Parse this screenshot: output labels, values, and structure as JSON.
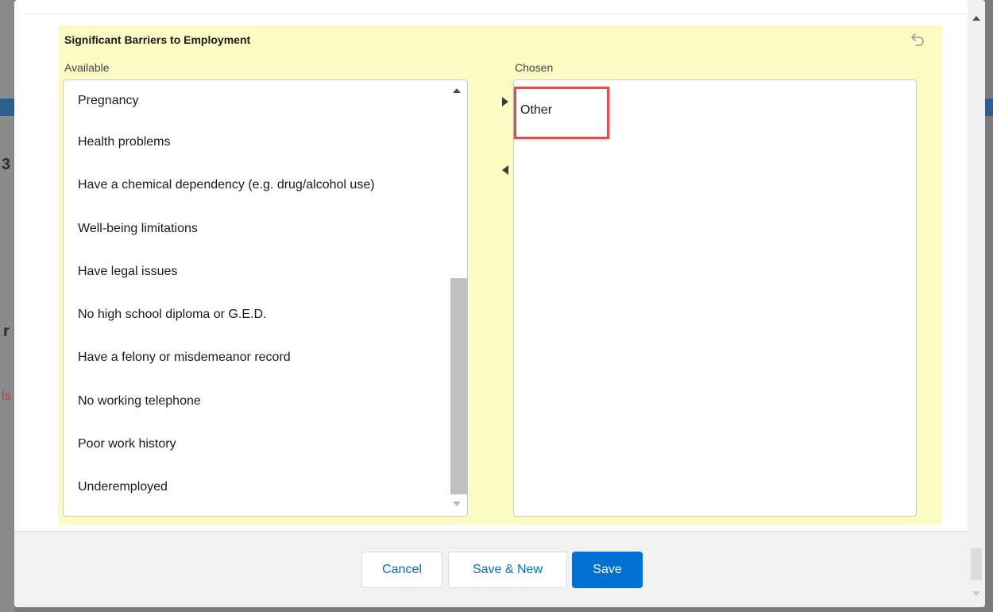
{
  "section": {
    "title": "Significant Barriers to Employment",
    "undo_icon": "undo-icon"
  },
  "dual_listbox": {
    "available_label": "Available",
    "chosen_label": "Chosen",
    "available_items": [
      "Pregnancy",
      "Health problems",
      "Have a chemical dependency (e.g. drug/alcohol use)",
      "Well-being limitations",
      "Have legal issues",
      "No high school diploma or G.E.D.",
      "Have a felony or misdemeanor record",
      "No working telephone",
      "Poor work history",
      "Underemployed"
    ],
    "chosen_items": [
      "Other"
    ],
    "move_right_icon": "triangle-right-icon",
    "move_left_icon": "triangle-left-icon",
    "highlight_color": "#e84b4b"
  },
  "footer": {
    "cancel_label": "Cancel",
    "save_new_label": "Save & New",
    "save_label": "Save"
  },
  "colors": {
    "section_background": "#fbfcc4",
    "brand": "#0070d2"
  },
  "background_page": {
    "fragment_1": "3",
    "fragment_2": "r",
    "fragment_3": "ls"
  }
}
